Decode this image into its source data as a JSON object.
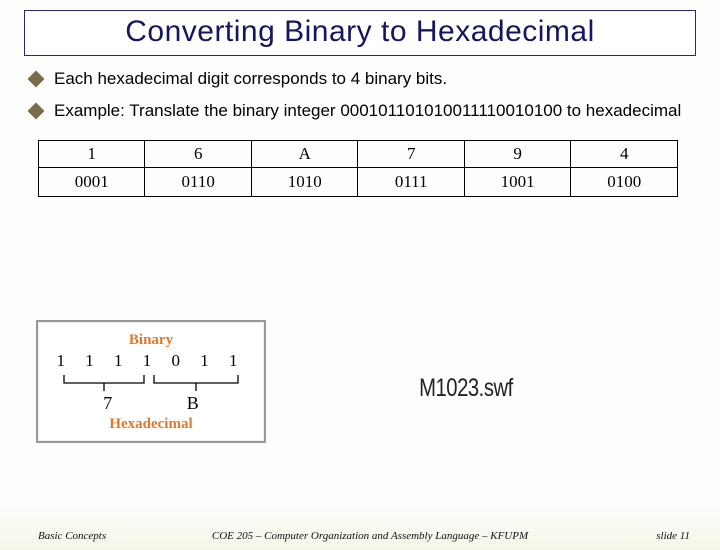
{
  "title": "Converting Binary to Hexadecimal",
  "bullets": [
    "Each hexadecimal digit corresponds to 4 binary bits.",
    "Example: Translate the binary integer 000101101010011110010100  to  hexadecimal"
  ],
  "table": {
    "hex": [
      "1",
      "6",
      "A",
      "7",
      "9",
      "4"
    ],
    "binary": [
      "0001",
      "0110",
      "1010",
      "0111",
      "1001",
      "0100"
    ]
  },
  "diagram": {
    "binary_label": "Binary",
    "bits": "1 1 1 1 0 1 1",
    "hex_left": "7",
    "hex_right": "B",
    "hex_label": "Hexadecimal"
  },
  "placeholder": "M1023.swf",
  "footer": {
    "left": "Basic Concepts",
    "center": "COE 205 – Computer Organization and Assembly Language – KFUPM",
    "right": "slide 11"
  }
}
